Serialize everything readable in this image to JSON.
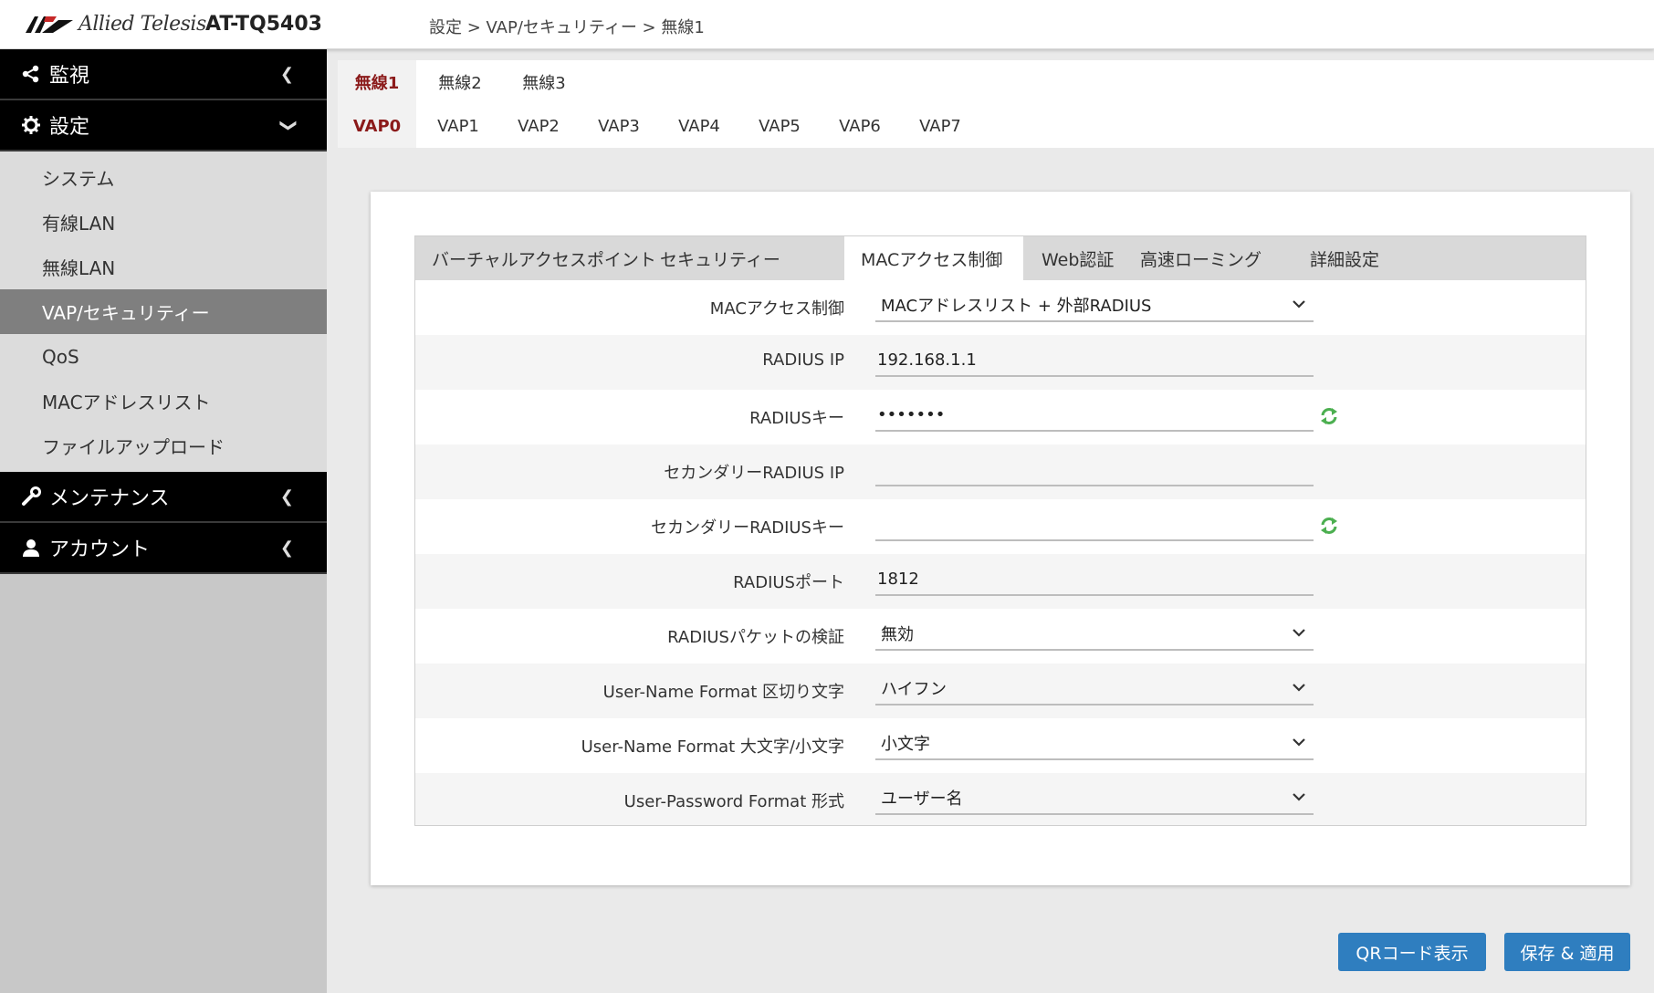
{
  "header": {
    "logo_text": "Allied Telesis",
    "model": "AT-TQ5403",
    "breadcrumb": "設定 > VAP/セキュリティー > 無線1"
  },
  "sidebar": {
    "sections": [
      {
        "label": "監視",
        "icon": "share-icon",
        "expanded": false
      },
      {
        "label": "設定",
        "icon": "gear-icon",
        "expanded": true
      },
      {
        "label": "メンテナンス",
        "icon": "wrench-icon",
        "expanded": false
      },
      {
        "label": "アカウント",
        "icon": "user-icon",
        "expanded": false
      }
    ],
    "settings_items": [
      "システム",
      "有線LAN",
      "無線LAN",
      "VAP/セキュリティー",
      "QoS",
      "MACアドレスリスト",
      "ファイルアップロード"
    ],
    "active_item": "VAP/セキュリティー"
  },
  "radio_tabs": [
    "無線1",
    "無線2",
    "無線3"
  ],
  "vap_tabs": [
    "VAP0",
    "VAP1",
    "VAP2",
    "VAP3",
    "VAP4",
    "VAP5",
    "VAP6",
    "VAP7"
  ],
  "sub_tabs": [
    "バーチャルアクセスポイント",
    "セキュリティー",
    "MACアクセス制御",
    "Web認証",
    "高速ローミング",
    "詳細設定"
  ],
  "form": {
    "mac_access_label": "MACアクセス制御",
    "mac_access_value": "MACアドレスリスト + 外部RADIUS",
    "radius_ip_label": "RADIUS IP",
    "radius_ip_value": "192.168.1.1",
    "radius_key_label": "RADIUSキー",
    "radius_key_value": "•••••••",
    "secondary_ip_label": "セカンダリーRADIUS IP",
    "secondary_ip_value": "",
    "secondary_key_label": "セカンダリーRADIUSキー",
    "secondary_key_value": "",
    "radius_port_label": "RADIUSポート",
    "radius_port_value": "1812",
    "packet_verify_label": "RADIUSパケットの検証",
    "packet_verify_value": "無効",
    "delimiter_label": "User-Name Format 区切り文字",
    "delimiter_value": "ハイフン",
    "case_label": "User-Name Format 大文字/小文字",
    "case_value": "小文字",
    "password_format_label": "User-Password Format 形式",
    "password_format_value": "ユーザー名"
  },
  "buttons": {
    "qr": "QRコード表示",
    "save": "保存 & 適用"
  },
  "colors": {
    "accent": "#2f7ebf",
    "active_tab_text": "#8b1a1a",
    "refresh_icon": "#4caf50"
  }
}
